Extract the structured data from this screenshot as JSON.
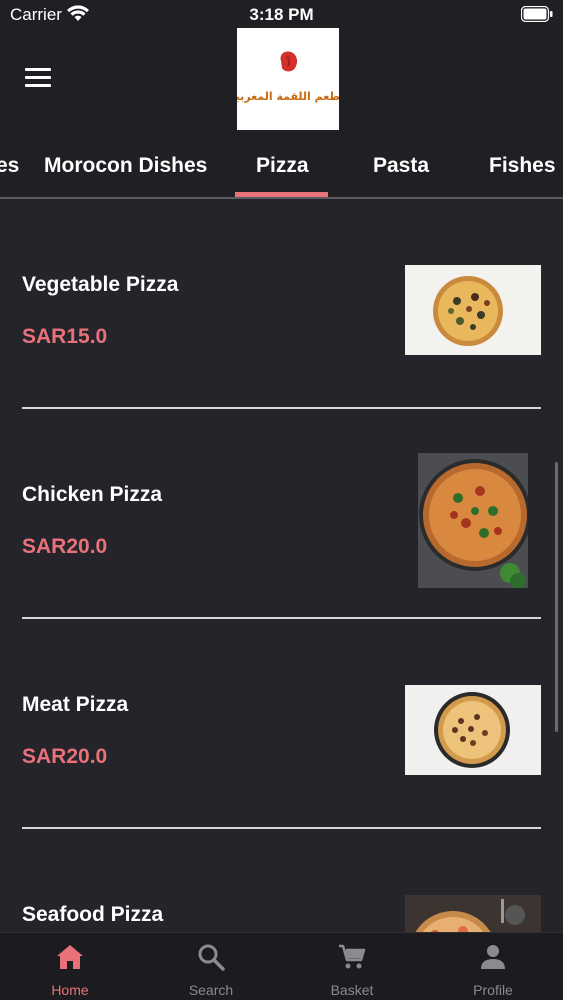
{
  "status_bar": {
    "carrier": "Carrier",
    "time": "3:18 PM"
  },
  "header": {
    "menu_icon": "hamburger-menu-icon",
    "logo": {
      "text": "مطعم اللقمة المغربية",
      "color": "#c8352a"
    }
  },
  "tabs": [
    {
      "label": "es"
    },
    {
      "label": "Morocon Dishes"
    },
    {
      "label": "Pizza",
      "active": true
    },
    {
      "label": "Pasta"
    },
    {
      "label": "Fishes"
    }
  ],
  "items": [
    {
      "name": "Vegetable Pizza",
      "price": "SAR15.0"
    },
    {
      "name": "Chicken Pizza",
      "price": "SAR20.0"
    },
    {
      "name": "Meat Pizza",
      "price": "SAR20.0"
    },
    {
      "name": "Seafood Pizza",
      "price": ""
    }
  ],
  "bottom_nav": [
    {
      "label": "Home",
      "icon": "home-icon",
      "active": true
    },
    {
      "label": "Search",
      "icon": "search-icon"
    },
    {
      "label": "Basket",
      "icon": "cart-icon"
    },
    {
      "label": "Profile",
      "icon": "profile-icon"
    }
  ],
  "colors": {
    "accent": "#e8717a",
    "background": "#24242a",
    "bar": "#1f1f24"
  }
}
